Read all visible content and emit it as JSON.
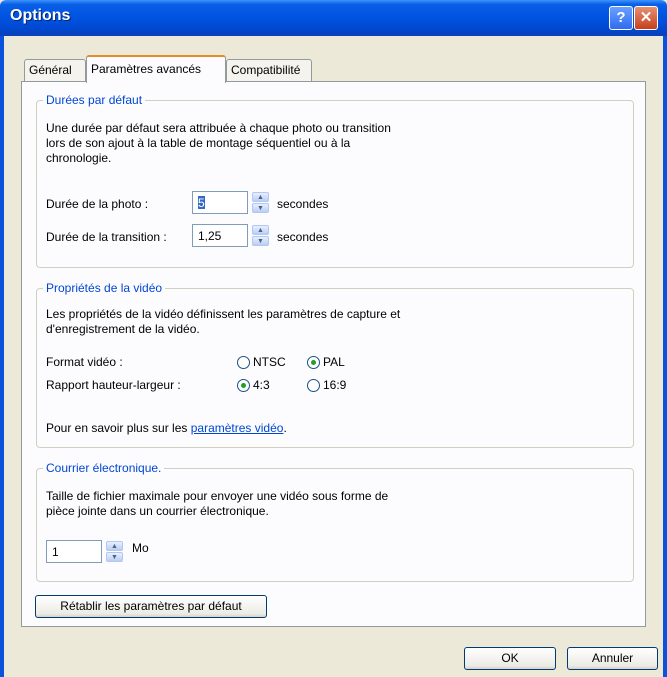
{
  "window": {
    "title": "Options"
  },
  "tabs": [
    {
      "label": "Général"
    },
    {
      "label": "Paramètres avancés"
    },
    {
      "label": "Compatibilité"
    }
  ],
  "durations": {
    "legend": "Durées par défaut",
    "description_lines": [
      "Une durée par défaut sera attribuée à chaque photo ou transition",
      "lors de son ajout à la table de montage séquentiel ou à la",
      "chronologie."
    ],
    "photo_label": "Durée de la photo :",
    "photo_value": "5",
    "transition_label": "Durée de la transition :",
    "transition_value": "1,25",
    "unit": "secondes"
  },
  "video": {
    "legend": "Propriétés de la vidéo",
    "description_lines": [
      "Les propriétés de la vidéo définissent les paramètres de capture et",
      "d'enregistrement de la vidéo."
    ],
    "format_label": "Format vidéo :",
    "format_options": [
      "NTSC",
      "PAL"
    ],
    "format_selected": "PAL",
    "ratio_label": "Rapport hauteur-largeur :",
    "ratio_options": [
      "4:3",
      "16:9"
    ],
    "ratio_selected": "4:3",
    "more_prefix": "Pour en savoir plus sur les ",
    "more_link": "paramètres vidéo",
    "more_suffix": "."
  },
  "email": {
    "legend": "Courrier électronique.",
    "description_lines": [
      "Taille de fichier maximale pour envoyer une vidéo sous forme de",
      "pièce jointe dans un courrier électronique."
    ],
    "value": "1",
    "unit": "Mo"
  },
  "buttons": {
    "restore": "Rétablir les paramètres par défaut",
    "ok": "OK",
    "cancel": "Annuler"
  }
}
